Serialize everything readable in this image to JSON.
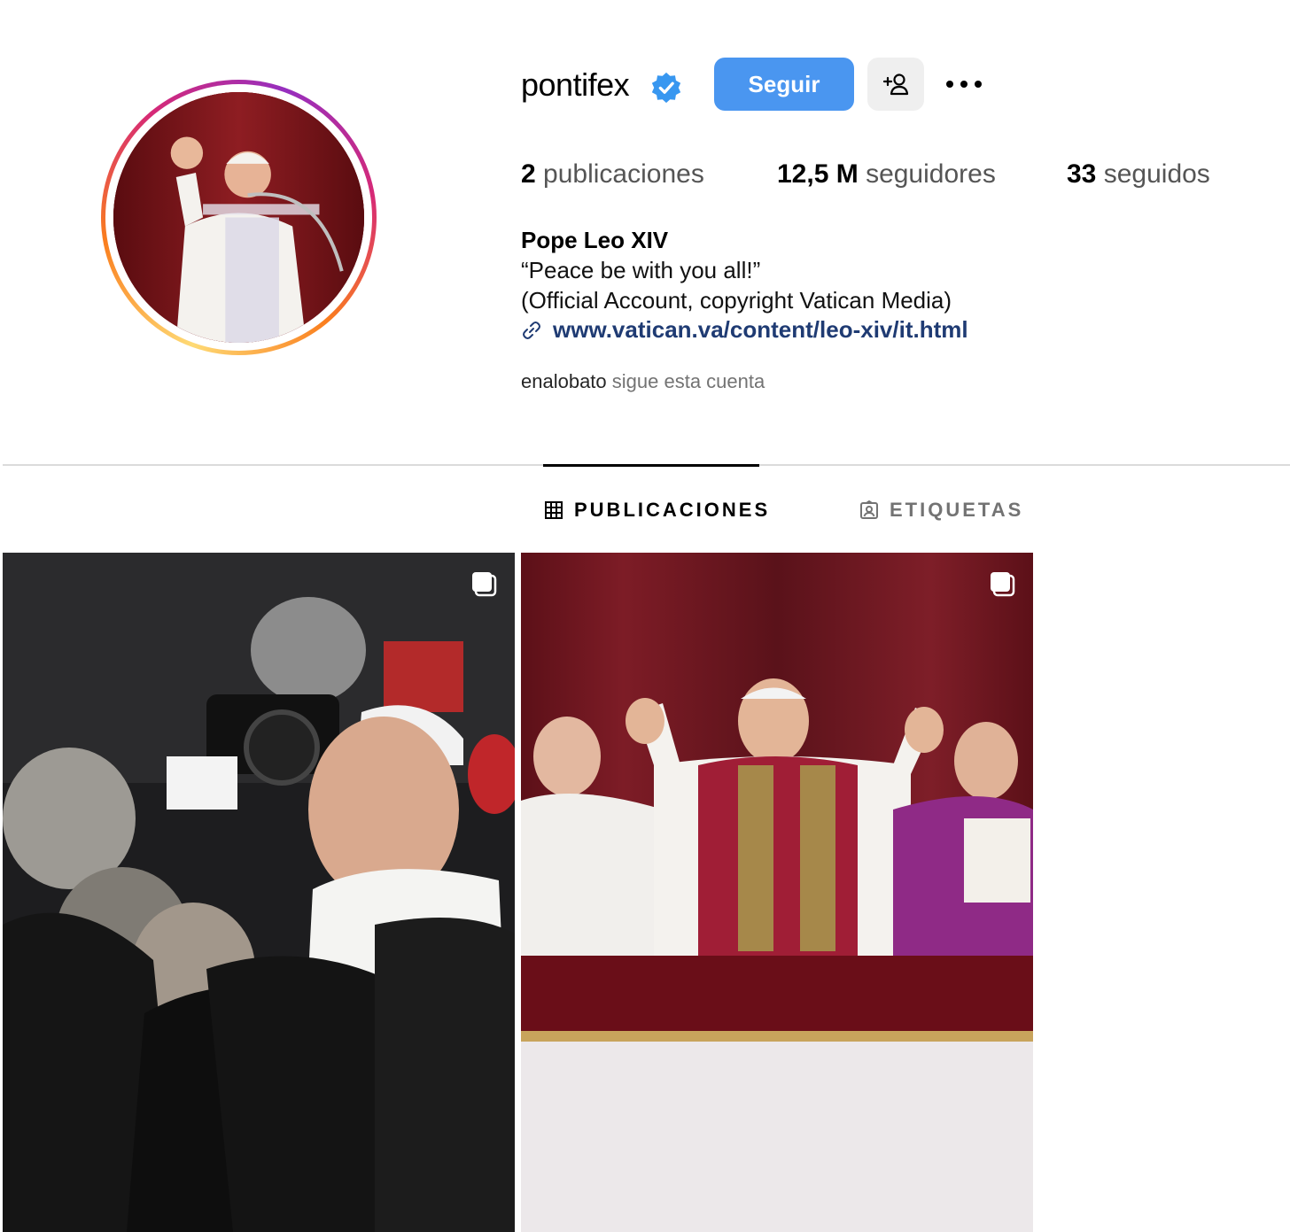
{
  "profile": {
    "username": "pontifex",
    "verified_icon": "verified-badge-icon",
    "follow_label": "Seguir",
    "suggest_icon": "add-person-icon",
    "more_icon": "more-options-icon",
    "accent_color": "#4a96f0"
  },
  "stats": {
    "posts_count": "2",
    "posts_label": "publicaciones",
    "followers_count": "12,5 M",
    "followers_label": "seguidores",
    "following_count": "33",
    "following_label": "seguidos"
  },
  "bio": {
    "name": "Pope Leo XIV",
    "quote": "“Peace be with you all!”",
    "note": "(Official Account, copyright Vatican Media)",
    "link": "www.vatican.va/content/leo-xiv/it.html",
    "link_icon": "link-icon"
  },
  "followed_by": {
    "user": "enalobato",
    "text": "sigue esta cuenta"
  },
  "tabs": [
    {
      "label": "PUBLICACIONES",
      "icon": "grid-icon",
      "active": true
    },
    {
      "label": "ETIQUETAS",
      "icon": "tagged-icon",
      "active": false
    }
  ],
  "posts": [
    {
      "icon": "carousel-icon"
    },
    {
      "icon": "carousel-icon"
    }
  ]
}
